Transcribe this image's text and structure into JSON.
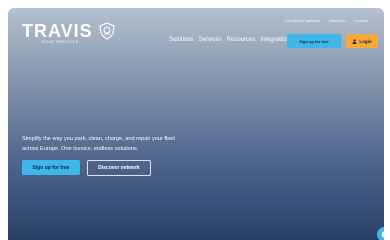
{
  "brand": {
    "name": "TRAVIS",
    "tagline": "ROAD SERVICES"
  },
  "utility_nav": [
    "For service partners",
    "About us",
    "Contact"
  ],
  "main_nav": [
    "Solutions",
    "Services",
    "Resources",
    "Integrations"
  ],
  "header_buttons": {
    "signup": "Sign up for free",
    "login": "Login"
  },
  "hero": {
    "line1": "Simplify the way you park, clean, charge, and repair your fleet",
    "line2": "across Europe. One invoice, endless solutions.",
    "cta_primary": "Sign up for free",
    "cta_secondary": "Discover network"
  },
  "icons": {
    "logo": "shield-crest-icon",
    "login": "person-icon",
    "chat": "chat-icon"
  },
  "colors": {
    "accent_blue": "#3fb6ea",
    "accent_orange": "#f7a93a",
    "bg_top": "#b3c0cf",
    "bg_bottom": "#2a3f63"
  }
}
